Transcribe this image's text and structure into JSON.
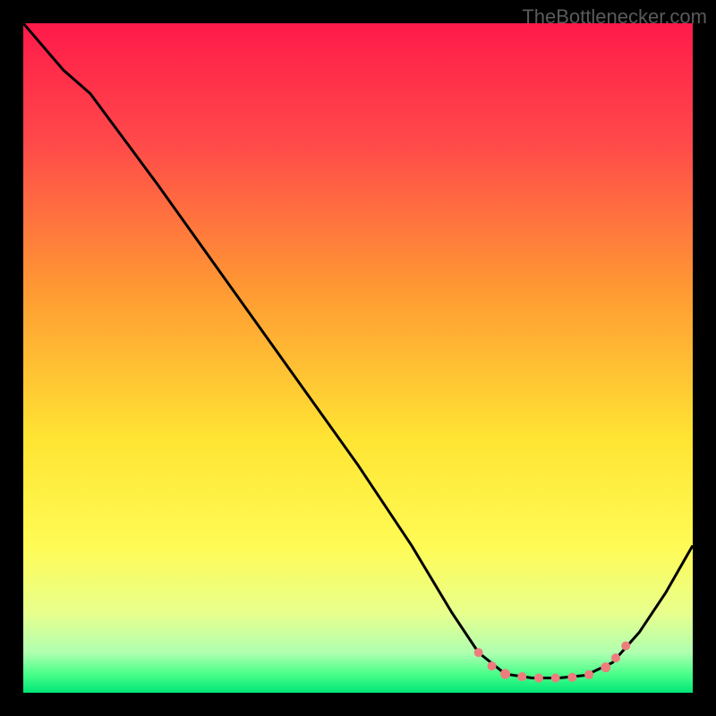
{
  "watermark": "TheBottlenecker.com",
  "chart_data": {
    "type": "line",
    "title": "",
    "xlabel": "",
    "ylabel": "",
    "xlim": [
      0,
      100
    ],
    "ylim": [
      0,
      100
    ],
    "background_gradient": {
      "stops": [
        {
          "offset": 0,
          "color": "#ff1a4a"
        },
        {
          "offset": 0.18,
          "color": "#ff4a4a"
        },
        {
          "offset": 0.4,
          "color": "#ff9a33"
        },
        {
          "offset": 0.62,
          "color": "#ffe433"
        },
        {
          "offset": 0.78,
          "color": "#fffb55"
        },
        {
          "offset": 0.88,
          "color": "#e8ff8c"
        },
        {
          "offset": 0.94,
          "color": "#b0ffb0"
        },
        {
          "offset": 0.972,
          "color": "#4aff8a"
        },
        {
          "offset": 1.0,
          "color": "#00e676"
        }
      ]
    },
    "curve": {
      "points": [
        {
          "x": 0,
          "y": 100
        },
        {
          "x": 6,
          "y": 93
        },
        {
          "x": 10,
          "y": 89.5
        },
        {
          "x": 20,
          "y": 76
        },
        {
          "x": 30,
          "y": 62
        },
        {
          "x": 40,
          "y": 48
        },
        {
          "x": 50,
          "y": 34
        },
        {
          "x": 58,
          "y": 22
        },
        {
          "x": 64,
          "y": 12
        },
        {
          "x": 68,
          "y": 6
        },
        {
          "x": 72,
          "y": 2.8
        },
        {
          "x": 76,
          "y": 2.2
        },
        {
          "x": 80,
          "y": 2.2
        },
        {
          "x": 84,
          "y": 2.6
        },
        {
          "x": 88,
          "y": 4.5
        },
        {
          "x": 92,
          "y": 9
        },
        {
          "x": 96,
          "y": 15
        },
        {
          "x": 100,
          "y": 22
        }
      ]
    },
    "markers": {
      "color": "#ed7d7d",
      "points": [
        {
          "x": 68,
          "y": 6,
          "r": 5
        },
        {
          "x": 70,
          "y": 4,
          "r": 5
        },
        {
          "x": 72,
          "y": 2.8,
          "r": 5.5
        },
        {
          "x": 74.5,
          "y": 2.4,
          "r": 5
        },
        {
          "x": 77,
          "y": 2.2,
          "r": 5
        },
        {
          "x": 79.5,
          "y": 2.2,
          "r": 5
        },
        {
          "x": 82,
          "y": 2.3,
          "r": 5
        },
        {
          "x": 84.5,
          "y": 2.7,
          "r": 5
        },
        {
          "x": 87,
          "y": 3.8,
          "r": 5.5
        },
        {
          "x": 88.5,
          "y": 5.2,
          "r": 5
        },
        {
          "x": 90,
          "y": 7,
          "r": 5
        }
      ]
    }
  }
}
